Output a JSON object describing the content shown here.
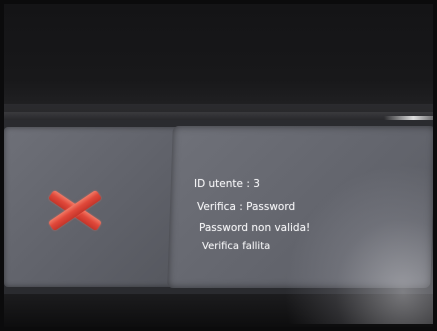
{
  "dialog": {
    "user_id_line": "ID utente : 3",
    "verify_line": "Verifica : Password",
    "error_line": "Password non valida!",
    "result_line": "Verifica fallita"
  },
  "status_icon": {
    "name": "error-x-icon",
    "color": "#e0483a"
  }
}
